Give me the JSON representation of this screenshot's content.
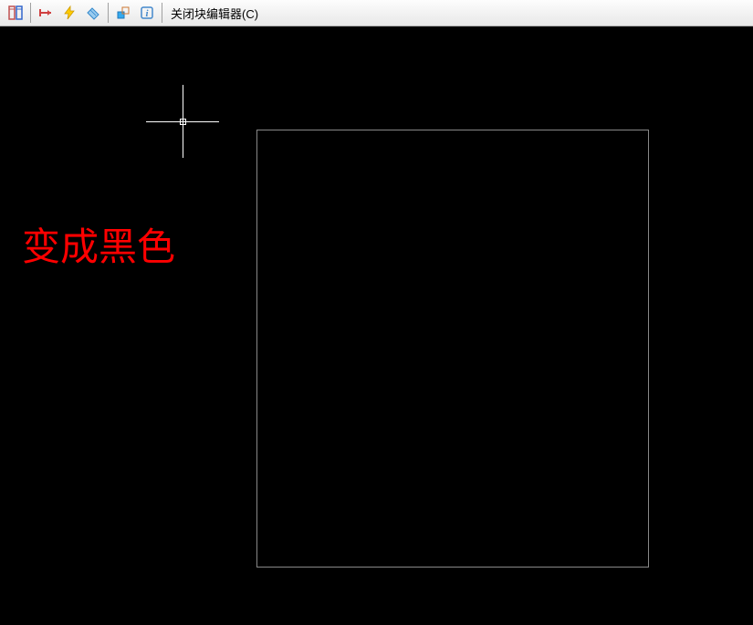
{
  "toolbar": {
    "close_block_editor_label": "关闭块编辑器(C)"
  },
  "annotation": {
    "text": "变成黑色"
  }
}
